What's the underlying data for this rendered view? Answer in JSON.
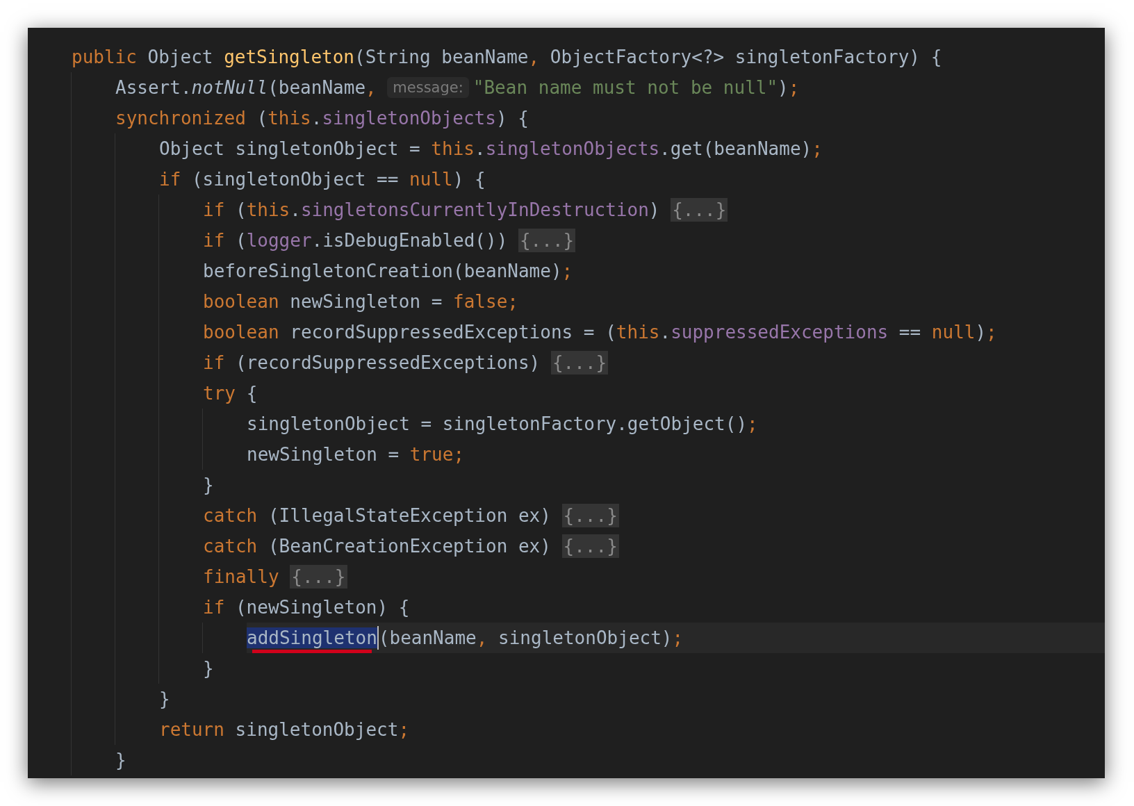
{
  "editor": {
    "lines": [
      {
        "tokens": [
          {
            "kind": "keyword",
            "text": "public "
          },
          {
            "kind": "plain",
            "text": "Object "
          },
          {
            "kind": "declaration",
            "text": "getSingleton"
          },
          {
            "kind": "plain",
            "text": "(String beanName"
          },
          {
            "kind": "punct",
            "text": ", "
          },
          {
            "kind": "plain",
            "text": "ObjectFactory<?> singletonFactory) {"
          }
        ],
        "children": [
          {
            "tokens": [
              {
                "kind": "plain",
                "text": "Assert."
              },
              {
                "kind": "italic",
                "text": "notNull"
              },
              {
                "kind": "plain",
                "text": "(beanName"
              },
              {
                "kind": "punct",
                "text": ", "
              },
              {
                "kind": "hint",
                "text": "message:"
              },
              {
                "kind": "string",
                "text": "\"Bean name must not be null\""
              },
              {
                "kind": "plain",
                "text": ")"
              },
              {
                "kind": "punct",
                "text": ";"
              }
            ]
          },
          {
            "tokens": [
              {
                "kind": "keyword",
                "text": "synchronized "
              },
              {
                "kind": "plain",
                "text": "("
              },
              {
                "kind": "keyword",
                "text": "this"
              },
              {
                "kind": "plain",
                "text": "."
              },
              {
                "kind": "field",
                "text": "singletonObjects"
              },
              {
                "kind": "plain",
                "text": ") {"
              }
            ],
            "children": [
              {
                "tokens": [
                  {
                    "kind": "plain",
                    "text": "Object singletonObject = "
                  },
                  {
                    "kind": "keyword",
                    "text": "this"
                  },
                  {
                    "kind": "plain",
                    "text": "."
                  },
                  {
                    "kind": "field",
                    "text": "singletonObjects"
                  },
                  {
                    "kind": "plain",
                    "text": ".get(beanName)"
                  },
                  {
                    "kind": "punct",
                    "text": ";"
                  }
                ]
              },
              {
                "tokens": [
                  {
                    "kind": "keyword",
                    "text": "if "
                  },
                  {
                    "kind": "plain",
                    "text": "(singletonObject == "
                  },
                  {
                    "kind": "keyword",
                    "text": "null"
                  },
                  {
                    "kind": "plain",
                    "text": ") {"
                  }
                ],
                "children": [
                  {
                    "tokens": [
                      {
                        "kind": "keyword",
                        "text": "if "
                      },
                      {
                        "kind": "plain",
                        "text": "("
                      },
                      {
                        "kind": "keyword",
                        "text": "this"
                      },
                      {
                        "kind": "plain",
                        "text": "."
                      },
                      {
                        "kind": "field",
                        "text": "singletonsCurrentlyInDestruction"
                      },
                      {
                        "kind": "plain",
                        "text": ") "
                      },
                      {
                        "kind": "fold",
                        "text": "{...}"
                      }
                    ]
                  },
                  {
                    "tokens": [
                      {
                        "kind": "keyword",
                        "text": "if "
                      },
                      {
                        "kind": "plain",
                        "text": "("
                      },
                      {
                        "kind": "field",
                        "text": "logger"
                      },
                      {
                        "kind": "plain",
                        "text": ".isDebugEnabled()) "
                      },
                      {
                        "kind": "fold",
                        "text": "{...}"
                      }
                    ]
                  },
                  {
                    "tokens": [
                      {
                        "kind": "plain",
                        "text": "beforeSingletonCreation(beanName)"
                      },
                      {
                        "kind": "punct",
                        "text": ";"
                      }
                    ]
                  },
                  {
                    "tokens": [
                      {
                        "kind": "keyword",
                        "text": "boolean "
                      },
                      {
                        "kind": "plain",
                        "text": "newSingleton = "
                      },
                      {
                        "kind": "keyword",
                        "text": "false"
                      },
                      {
                        "kind": "punct",
                        "text": ";"
                      }
                    ]
                  },
                  {
                    "tokens": [
                      {
                        "kind": "keyword",
                        "text": "boolean "
                      },
                      {
                        "kind": "plain",
                        "text": "recordSuppressedExceptions = ("
                      },
                      {
                        "kind": "keyword",
                        "text": "this"
                      },
                      {
                        "kind": "plain",
                        "text": "."
                      },
                      {
                        "kind": "field",
                        "text": "suppressedExceptions"
                      },
                      {
                        "kind": "plain",
                        "text": " == "
                      },
                      {
                        "kind": "keyword",
                        "text": "null"
                      },
                      {
                        "kind": "plain",
                        "text": ")"
                      },
                      {
                        "kind": "punct",
                        "text": ";"
                      }
                    ]
                  },
                  {
                    "tokens": [
                      {
                        "kind": "keyword",
                        "text": "if "
                      },
                      {
                        "kind": "plain",
                        "text": "(recordSuppressedExceptions) "
                      },
                      {
                        "kind": "fold",
                        "text": "{...}"
                      }
                    ]
                  },
                  {
                    "tokens": [
                      {
                        "kind": "keyword",
                        "text": "try "
                      },
                      {
                        "kind": "plain",
                        "text": "{"
                      }
                    ],
                    "children": [
                      {
                        "tokens": [
                          {
                            "kind": "plain",
                            "text": "singletonObject = singletonFactory.getObject()"
                          },
                          {
                            "kind": "punct",
                            "text": ";"
                          }
                        ]
                      },
                      {
                        "tokens": [
                          {
                            "kind": "plain",
                            "text": "newSingleton = "
                          },
                          {
                            "kind": "keyword",
                            "text": "true"
                          },
                          {
                            "kind": "punct",
                            "text": ";"
                          }
                        ]
                      }
                    ]
                  },
                  {
                    "tokens": [
                      {
                        "kind": "plain",
                        "text": "}"
                      }
                    ]
                  },
                  {
                    "tokens": [
                      {
                        "kind": "keyword",
                        "text": "catch "
                      },
                      {
                        "kind": "plain",
                        "text": "(IllegalStateException ex) "
                      },
                      {
                        "kind": "fold",
                        "text": "{...}"
                      }
                    ]
                  },
                  {
                    "tokens": [
                      {
                        "kind": "keyword",
                        "text": "catch "
                      },
                      {
                        "kind": "plain",
                        "text": "(BeanCreationException ex) "
                      },
                      {
                        "kind": "fold",
                        "text": "{...}"
                      }
                    ]
                  },
                  {
                    "tokens": [
                      {
                        "kind": "keyword",
                        "text": "finally "
                      },
                      {
                        "kind": "fold",
                        "text": "{...}"
                      }
                    ]
                  },
                  {
                    "tokens": [
                      {
                        "kind": "keyword",
                        "text": "if "
                      },
                      {
                        "kind": "plain",
                        "text": "(newSingleton) {"
                      }
                    ],
                    "children": [
                      {
                        "current": true,
                        "tokens": [
                          {
                            "kind": "selection",
                            "text": "addSingleton"
                          },
                          {
                            "kind": "plain",
                            "text": "(beanName"
                          },
                          {
                            "kind": "punct",
                            "text": ", "
                          },
                          {
                            "kind": "plain",
                            "text": "singletonObject)"
                          },
                          {
                            "kind": "punct",
                            "text": ";"
                          }
                        ]
                      }
                    ]
                  },
                  {
                    "tokens": [
                      {
                        "kind": "plain",
                        "text": "}"
                      }
                    ]
                  }
                ]
              },
              {
                "tokens": [
                  {
                    "kind": "plain",
                    "text": "}"
                  }
                ]
              },
              {
                "tokens": [
                  {
                    "kind": "keyword",
                    "text": "return "
                  },
                  {
                    "kind": "plain",
                    "text": "singletonObject"
                  },
                  {
                    "kind": "punct",
                    "text": ";"
                  }
                ]
              }
            ]
          },
          {
            "tokens": [
              {
                "kind": "plain",
                "text": "}"
              }
            ]
          }
        ]
      }
    ]
  }
}
